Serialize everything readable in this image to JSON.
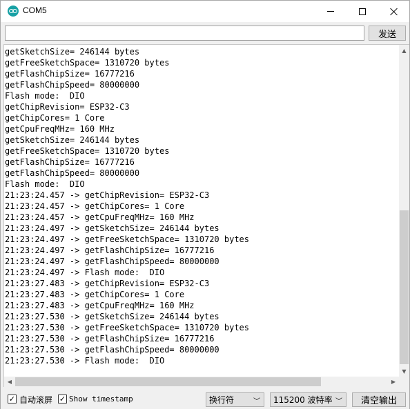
{
  "window": {
    "title": "COM5",
    "accent_color": "#17a1a5"
  },
  "send_bar": {
    "input_value": "",
    "send_label": "发送"
  },
  "output": {
    "lines": [
      "getSketchSize= 246144 bytes",
      "getFreeSketchSpace= 1310720 bytes",
      "getFlashChipSize= 16777216",
      "getFlashChipSpeed= 80000000",
      "Flash mode:  DIO",
      "getChipRevision= ESP32-C3",
      "getChipCores= 1 Core",
      "getCpuFreqMHz= 160 MHz",
      "getSketchSize= 246144 bytes",
      "getFreeSketchSpace= 1310720 bytes",
      "getFlashChipSize= 16777216",
      "getFlashChipSpeed= 80000000",
      "Flash mode:  DIO",
      "21:23:24.457 -> getChipRevision= ESP32-C3",
      "21:23:24.457 -> getChipCores= 1 Core",
      "21:23:24.457 -> getCpuFreqMHz= 160 MHz",
      "21:23:24.497 -> getSketchSize= 246144 bytes",
      "21:23:24.497 -> getFreeSketchSpace= 1310720 bytes",
      "21:23:24.497 -> getFlashChipSize= 16777216",
      "21:23:24.497 -> getFlashChipSpeed= 80000000",
      "21:23:24.497 -> Flash mode:  DIO",
      "21:23:27.483 -> getChipRevision= ESP32-C3",
      "21:23:27.483 -> getChipCores= 1 Core",
      "21:23:27.483 -> getCpuFreqMHz= 160 MHz",
      "21:23:27.530 -> getSketchSize= 246144 bytes",
      "21:23:27.530 -> getFreeSketchSpace= 1310720 bytes",
      "21:23:27.530 -> getFlashChipSize= 16777216",
      "21:23:27.530 -> getFlashChipSpeed= 80000000",
      "21:23:27.530 -> Flash mode:  DIO"
    ]
  },
  "bottom_bar": {
    "autoscroll_label": "自动滚屏",
    "autoscroll_checked": true,
    "timestamp_label": "Show timestamp",
    "timestamp_checked": true,
    "line_ending_value": "换行符",
    "baud_value": "115200 波特率",
    "clear_label": "清空输出"
  }
}
